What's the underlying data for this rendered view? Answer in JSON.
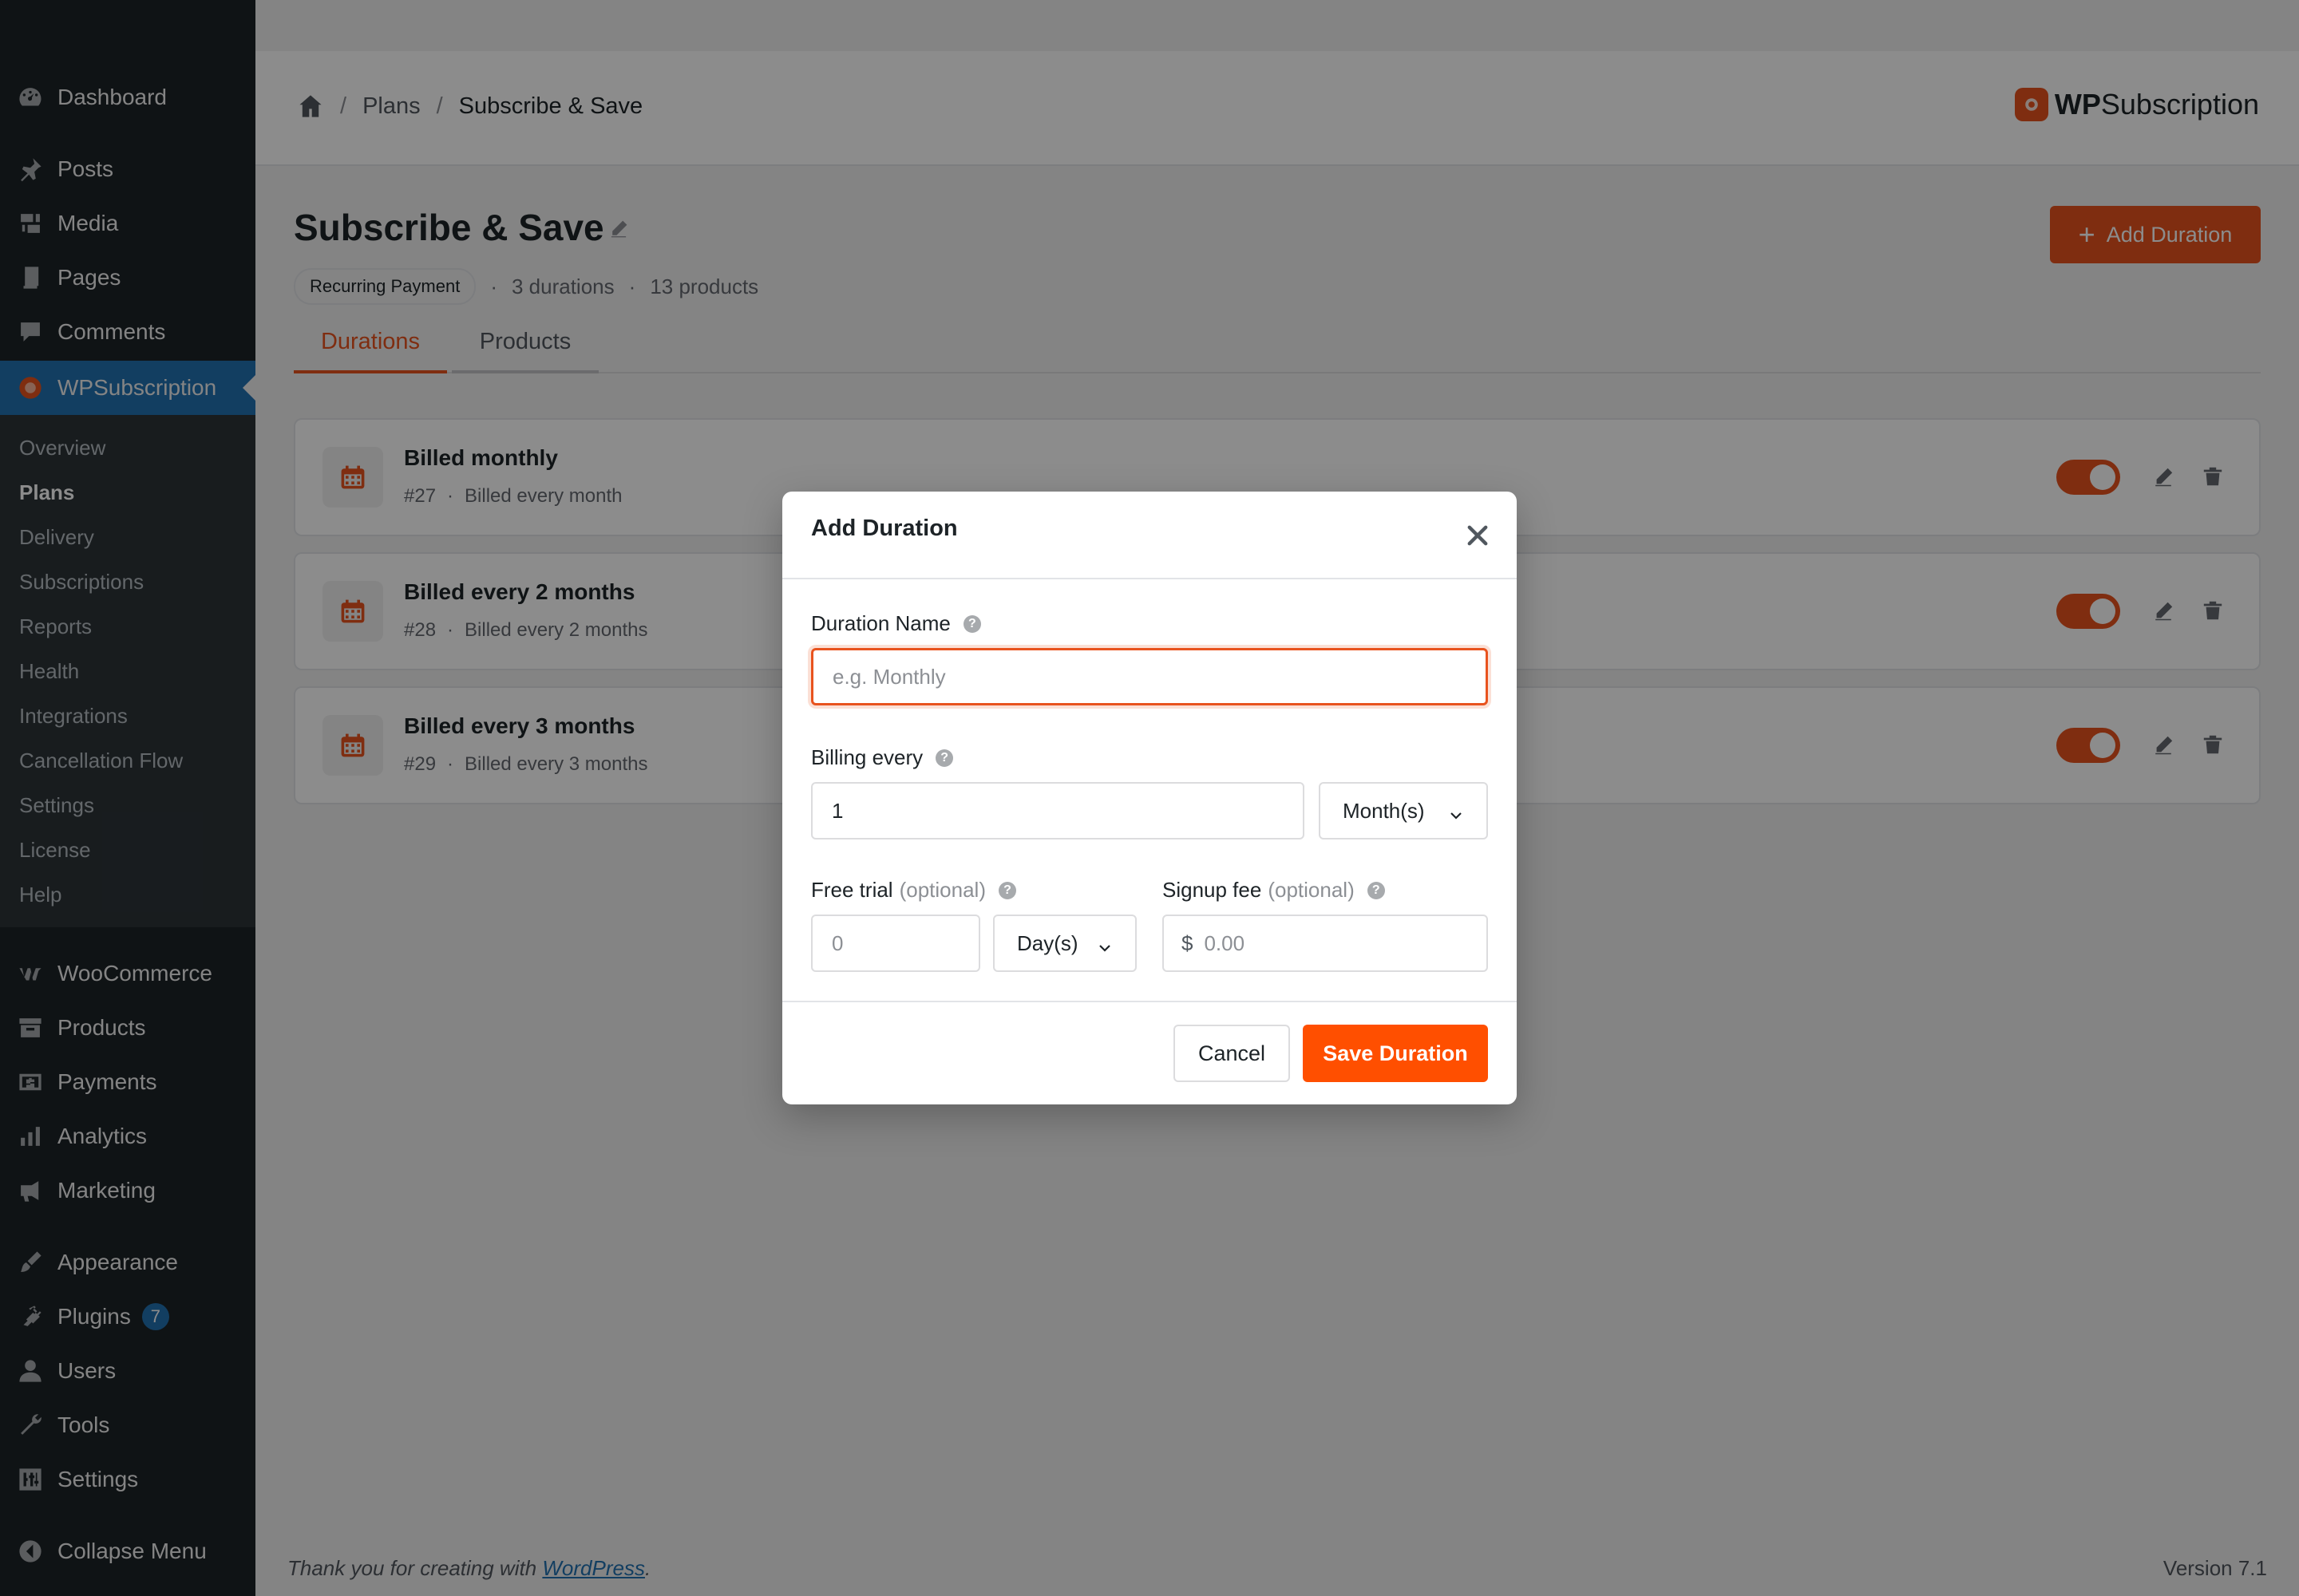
{
  "sidebar": {
    "top_items": [
      {
        "label": "Dashboard",
        "icon": "dashboard-icon"
      },
      {
        "label": "Posts",
        "icon": "pin-icon"
      },
      {
        "label": "Media",
        "icon": "media-icon"
      },
      {
        "label": "Pages",
        "icon": "pages-icon"
      },
      {
        "label": "Comments",
        "icon": "comment-icon"
      },
      {
        "label": "WPSubscription",
        "icon": "wpsubscription-icon"
      }
    ],
    "submenu": [
      "Overview",
      "Plans",
      "Delivery",
      "Subscriptions",
      "Reports",
      "Health",
      "Integrations",
      "Cancellation Flow",
      "Settings",
      "License",
      "Help"
    ],
    "bottom_items": [
      {
        "label": "WooCommerce",
        "icon": "woocommerce-icon"
      },
      {
        "label": "Products",
        "icon": "archive-icon"
      },
      {
        "label": "Payments",
        "icon": "payments-icon"
      },
      {
        "label": "Analytics",
        "icon": "bar-chart-icon"
      },
      {
        "label": "Marketing",
        "icon": "megaphone-icon"
      },
      {
        "label": "Appearance",
        "icon": "brush-icon"
      },
      {
        "label": "Plugins",
        "icon": "plug-icon",
        "badge": "7"
      },
      {
        "label": "Users",
        "icon": "user-icon"
      },
      {
        "label": "Tools",
        "icon": "wrench-icon"
      },
      {
        "label": "Settings",
        "icon": "sliders-icon"
      }
    ],
    "collapse": "Collapse Menu"
  },
  "header": {
    "breadcrumb": {
      "plans": "Plans",
      "sep": "/",
      "current": "Subscribe & Save"
    },
    "brand_bold": "WP",
    "brand_rest": "Subscription"
  },
  "page": {
    "title": "Subscribe & Save",
    "type_pill": "Recurring Payment",
    "dot": "·",
    "durations_count": "3 durations",
    "products_count": "13 products",
    "add_button": "Add Duration",
    "add_plus": "+",
    "tabs": {
      "durations": "Durations",
      "products": "Products"
    }
  },
  "durations": [
    {
      "title": "Billed monthly",
      "id": "#27",
      "desc": "Billed every month"
    },
    {
      "title": "Billed every 2 months",
      "id": "#28",
      "desc": "Billed every 2 months"
    },
    {
      "title": "Billed every 3 months",
      "id": "#29",
      "desc": "Billed every 3 months"
    }
  ],
  "footer": {
    "thanks_prefix": "Thank you for creating with ",
    "wp_link": "WordPress",
    "thanks_suffix": ".",
    "version": "Version 7.1"
  },
  "modal": {
    "title": "Add Duration",
    "duration_name_label": "Duration Name",
    "duration_name_placeholder": "e.g. Monthly",
    "help_glyph": "?",
    "billing_every_label": "Billing every",
    "billing_every_value": "1",
    "billing_unit": "Month(s)",
    "free_trial_label": "Free trial",
    "optional": "(optional)",
    "free_trial_placeholder": "0",
    "trial_unit": "Day(s)",
    "signup_fee_label": "Signup fee",
    "currency": "$",
    "signup_fee_placeholder": "0.00",
    "cancel": "Cancel",
    "save": "Save Duration"
  },
  "colors": {
    "accent": "#e8531e",
    "save": "#ff4f00",
    "admin_blue": "#2271b1",
    "sidebar": "#1d2327"
  }
}
